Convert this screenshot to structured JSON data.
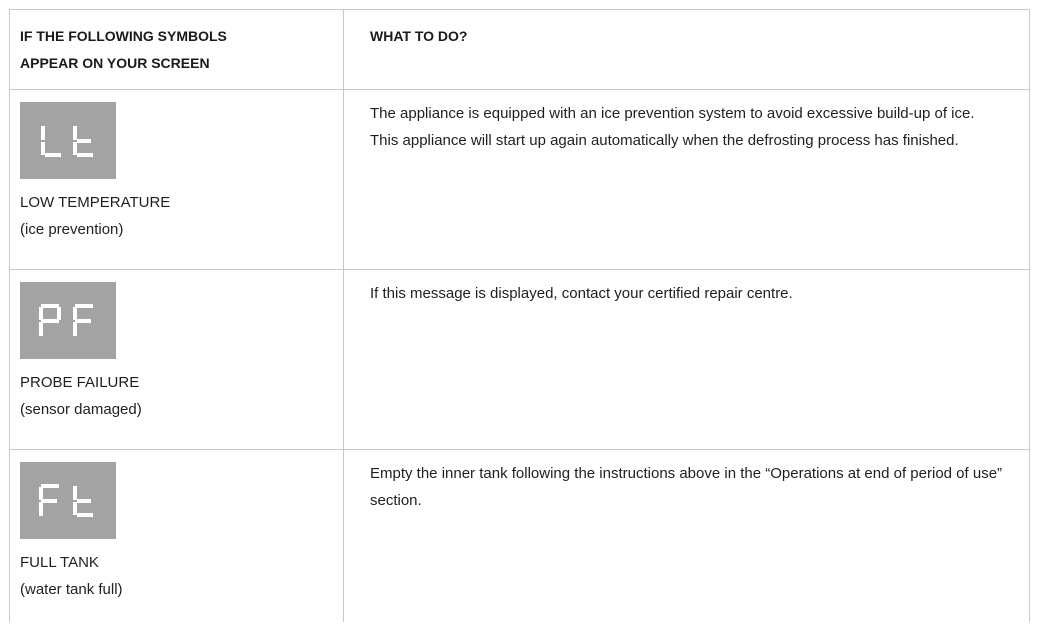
{
  "header": {
    "col1_line1": "IF THE FOLLOWING SYMBOLS",
    "col1_line2": "APPEAR ON YOUR SCREEN",
    "col2": "WHAT TO DO?"
  },
  "rows": [
    {
      "symbol": "Lt",
      "symbol_icon": "display-lt-icon",
      "name": "LOW TEMPERATURE",
      "detail": "(ice prevention)",
      "desc_p1": "The appliance is equipped with an ice prevention system to avoid excessive build-up of ice.",
      "desc_p2": "This appliance will start up again automatically when the defrosting process has finished."
    },
    {
      "symbol": "PF",
      "symbol_icon": "display-pf-icon",
      "name": "PROBE FAILURE",
      "detail": "(sensor damaged)",
      "desc_p1": "If this message is displayed, contact your certified repair centre."
    },
    {
      "symbol": "Ft",
      "symbol_icon": "display-ft-icon",
      "name": "FULL TANK",
      "detail": "(water tank full)",
      "desc_p1": "Empty the inner tank following the instructions above in the “Operations at end of period of use” section."
    }
  ],
  "colors": {
    "symbol_bg": "#a3a3a3",
    "segment": "#ffffff",
    "border": "#c9c9c9"
  }
}
